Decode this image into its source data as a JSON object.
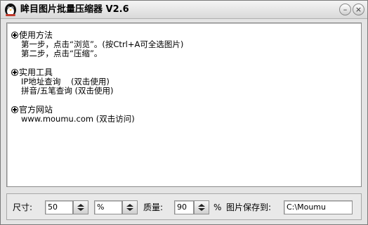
{
  "window": {
    "title": "眸目图片批量压缩器 V2.6",
    "app_icon": "penguin-icon",
    "minimize_glyph": "–",
    "close_glyph": "×"
  },
  "sections": {
    "usage": {
      "heading": "使用方法",
      "lines": [
        "第一步，点击“浏览”。(按Ctrl+A可全选图片)",
        "第二步，点击“压缩”。"
      ]
    },
    "tools": {
      "heading": "实用工具",
      "lines": [
        "IP地址查询    (双击使用)",
        "拼音/五笔查询 (双击使用)"
      ]
    },
    "website": {
      "heading": "官方网站",
      "lines": [
        "www.moumu.com (双击访问)"
      ]
    }
  },
  "toolbar": {
    "size_label": "尺寸:",
    "size_value": "50",
    "unit_value": "%",
    "quality_label": "质量:",
    "quality_value": "90",
    "percent_symbol": "%",
    "save_label": "图片保存到:",
    "save_path": "C:\\Moumu"
  }
}
